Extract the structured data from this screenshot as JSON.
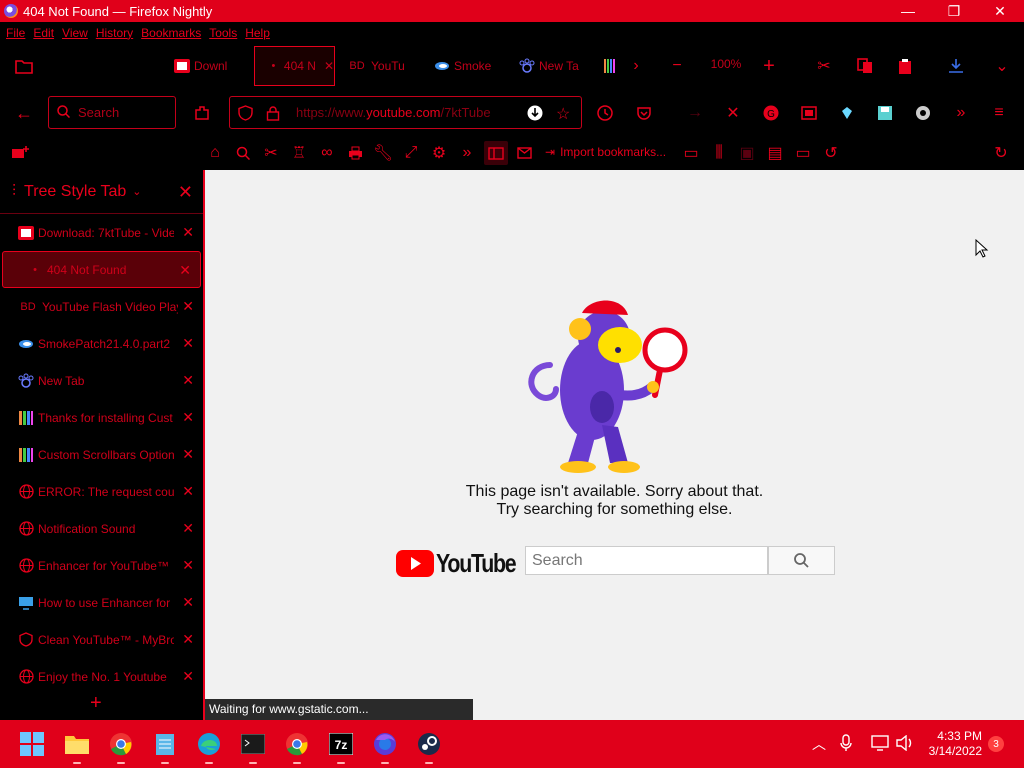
{
  "window": {
    "title": "404 Not Found — Firefox Nightly",
    "minimize": "—",
    "maximize": "❐",
    "close": "✕"
  },
  "menu": [
    "File",
    "Edit",
    "View",
    "History",
    "Bookmarks",
    "Tools",
    "Help"
  ],
  "tabs": [
    {
      "label": "Downl",
      "icon": "youtube-icon"
    },
    {
      "label": "404 N",
      "icon": "dot-icon",
      "active": true
    },
    {
      "label": "YouTu",
      "icon": "bd-icon"
    },
    {
      "label": "Smoke",
      "icon": "smoke-icon"
    },
    {
      "label": "New Ta",
      "icon": "paw-icon"
    }
  ],
  "toolbar": {
    "zoom": "100%",
    "search_placeholder": "Search",
    "url_prefix": "https://www.",
    "url_domain": "youtube.com",
    "url_suffix": "/7ktTube"
  },
  "bookmarks": {
    "import_label": "Import bookmarks..."
  },
  "sidebar": {
    "title": "Tree Style Tab",
    "items": [
      {
        "label": "Download: 7ktTube - Vide",
        "icon": "youtube-icon"
      },
      {
        "label": "404 Not Found",
        "icon": "dot-icon",
        "active": true
      },
      {
        "label": "YouTube Flash Video Play",
        "icon": "bd-icon"
      },
      {
        "label": "SmokePatch21.4.0.part2",
        "icon": "smoke-icon"
      },
      {
        "label": "New Tab",
        "icon": "paw-icon"
      },
      {
        "label": "Thanks for installing Cust",
        "icon": "bars-icon"
      },
      {
        "label": "Custom Scrollbars Options",
        "icon": "bars-icon"
      },
      {
        "label": "ERROR: The request coul",
        "icon": "globe-icon"
      },
      {
        "label": "Notification Sound",
        "icon": "globe-icon"
      },
      {
        "label": "Enhancer for YouTube™",
        "icon": "globe-icon"
      },
      {
        "label": "How to use Enhancer for",
        "icon": "monitor-icon"
      },
      {
        "label": "Clean YouTube™ - MyBro",
        "icon": "shield-icon"
      },
      {
        "label": "Enjoy the No. 1 Youtube",
        "icon": "globe-icon"
      }
    ],
    "new_tab": "+"
  },
  "page": {
    "line1": "This page isn't available. Sorry about that.",
    "line2": "Try searching for something else.",
    "logo_text": "YouTube",
    "search_placeholder": "Search"
  },
  "status": "Waiting for www.gstatic.com...",
  "taskbar": {
    "time": "4:33 PM",
    "date": "3/14/2022",
    "notifications": "3"
  }
}
